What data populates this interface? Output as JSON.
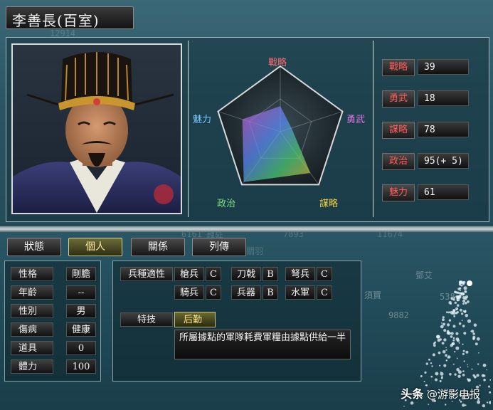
{
  "title": "李善長(百室)",
  "header_ghost_number": "12914",
  "radar": {
    "labels": {
      "strategy": "戰略",
      "valor": "勇武",
      "tactics": "謀略",
      "politics": "政治",
      "charisma": "魅力"
    },
    "colors": {
      "strategy": "#ff6a6a",
      "valor": "#e27ae6",
      "tactics": "#f0d040",
      "politics": "#7fe07f",
      "charisma": "#7ac8ff"
    }
  },
  "stats": [
    {
      "label": "戰略",
      "value": "39"
    },
    {
      "label": "勇武",
      "value": "18"
    },
    {
      "label": "謀略",
      "value": "78"
    },
    {
      "label": "政治",
      "value": "95(+ 5)"
    },
    {
      "label": "魅力",
      "value": "61"
    }
  ],
  "tabs": [
    {
      "label": "狀態",
      "active": false
    },
    {
      "label": "個人",
      "active": true
    },
    {
      "label": "關係",
      "active": false
    },
    {
      "label": "列傳",
      "active": false
    }
  ],
  "personal": [
    {
      "label": "性格",
      "value": "剛膽"
    },
    {
      "label": "年齡",
      "value": "--"
    },
    {
      "label": "性別",
      "value": "男"
    },
    {
      "label": "傷病",
      "value": "健康"
    },
    {
      "label": "道具",
      "value": "0"
    },
    {
      "label": "體力",
      "value": "100"
    }
  ],
  "aptitude": {
    "label": "兵種適性",
    "cells": [
      {
        "name": "槍兵",
        "grade": "C"
      },
      {
        "name": "刀戟",
        "grade": "B"
      },
      {
        "name": "弩兵",
        "grade": "C"
      },
      {
        "name": "騎兵",
        "grade": "C"
      },
      {
        "name": "兵器",
        "grade": "B"
      },
      {
        "name": "水軍",
        "grade": "C"
      }
    ]
  },
  "skill": {
    "label": "特技",
    "name": "后勤",
    "description": "所屬據點的軍隊耗費軍糧由據點供給一半"
  },
  "background_ghost": {
    "n1": "6161",
    "n2": "7893",
    "n3": "11674",
    "n4": "9882",
    "n5": "538",
    "t1": "魏延",
    "t2": "關羽",
    "t3": "鄧艾",
    "t4": "須賈"
  },
  "watermark": {
    "brand": "头条",
    "text": "@游影电报"
  }
}
